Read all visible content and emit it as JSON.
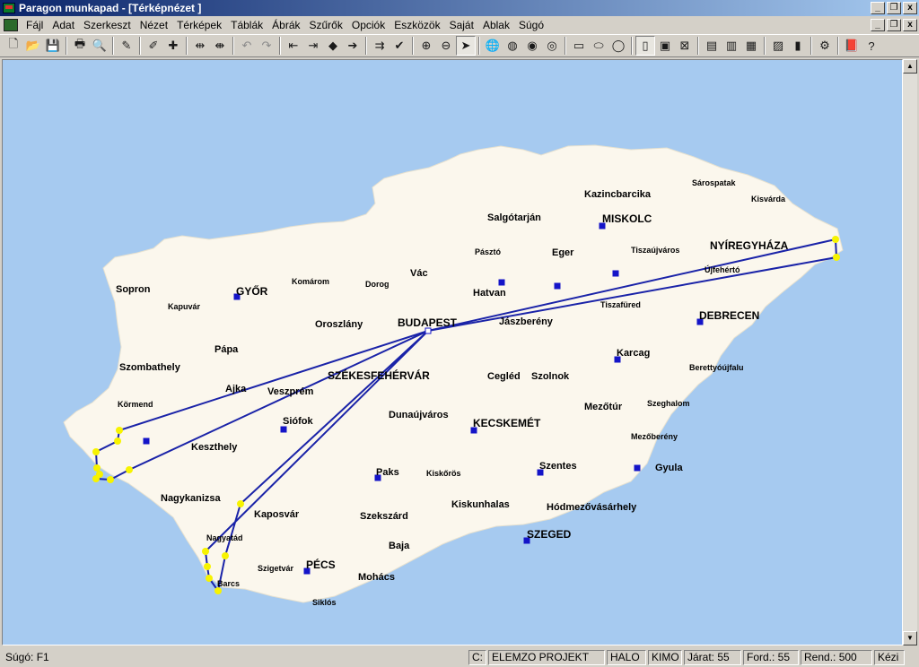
{
  "window": {
    "title": "Paragon munkapad - [Térképnézet ]",
    "min_glyph": "_",
    "max_glyph": "❐",
    "close_glyph": "x"
  },
  "menu": [
    "Fájl",
    "Adat",
    "Szerkeszt",
    "Nézet",
    "Térképek",
    "Táblák",
    "Ábrák",
    "Szűrők",
    "Opciók",
    "Eszközök",
    "Saját",
    "Ablak",
    "Súgó"
  ],
  "toolbar": [
    {
      "name": "new-icon",
      "glyph": "🗋",
      "state": "normal"
    },
    {
      "name": "open-icon",
      "glyph": "📂",
      "state": "normal"
    },
    {
      "name": "save-icon",
      "glyph": "💾",
      "state": "normal"
    },
    {
      "sep": true
    },
    {
      "name": "print-icon",
      "glyph": "🖶",
      "state": "normal"
    },
    {
      "name": "print-preview-icon",
      "glyph": "🔍",
      "state": "normal"
    },
    {
      "sep": true
    },
    {
      "name": "edit-table-icon",
      "glyph": "✎",
      "state": "normal"
    },
    {
      "sep": true
    },
    {
      "name": "edit-route-icon",
      "glyph": "✐",
      "state": "normal"
    },
    {
      "name": "add-stop-icon",
      "glyph": "✚",
      "state": "normal"
    },
    {
      "sep": true
    },
    {
      "name": "join-route-icon",
      "glyph": "⇹",
      "state": "normal"
    },
    {
      "name": "split-route-icon",
      "glyph": "⇼",
      "state": "normal"
    },
    {
      "sep": true
    },
    {
      "name": "undo-icon",
      "glyph": "↶",
      "state": "disabled"
    },
    {
      "name": "redo-icon",
      "glyph": "↷",
      "state": "disabled"
    },
    {
      "sep": true
    },
    {
      "name": "insert-before-icon",
      "glyph": "⇤",
      "state": "normal"
    },
    {
      "name": "insert-after-icon",
      "glyph": "⇥",
      "state": "normal"
    },
    {
      "name": "move-left-icon",
      "glyph": "◆",
      "state": "normal"
    },
    {
      "name": "move-right-icon",
      "glyph": "➔",
      "state": "normal"
    },
    {
      "sep": true
    },
    {
      "name": "route-arrow-icon",
      "glyph": "⇉",
      "state": "normal"
    },
    {
      "name": "check-route-icon",
      "glyph": "✔",
      "state": "normal"
    },
    {
      "sep": true
    },
    {
      "name": "zoom-in-icon",
      "glyph": "⊕",
      "state": "normal"
    },
    {
      "name": "zoom-out-icon",
      "glyph": "⊖",
      "state": "normal"
    },
    {
      "name": "pointer-icon",
      "glyph": "➤",
      "state": "pressed"
    },
    {
      "sep": true
    },
    {
      "name": "globe-icon",
      "glyph": "🌐",
      "state": "normal"
    },
    {
      "name": "globe-zoom-icon",
      "glyph": "◍",
      "state": "normal"
    },
    {
      "name": "globe-layers-icon",
      "glyph": "◉",
      "state": "normal"
    },
    {
      "name": "globe-settings-icon",
      "glyph": "◎",
      "state": "normal"
    },
    {
      "sep": true
    },
    {
      "name": "select-rect-icon",
      "glyph": "▭",
      "state": "normal"
    },
    {
      "name": "select-lasso-icon",
      "glyph": "⬭",
      "state": "normal"
    },
    {
      "name": "select-circle-icon",
      "glyph": "◯",
      "state": "normal"
    },
    {
      "sep": true
    },
    {
      "name": "select-column-icon",
      "glyph": "▯",
      "state": "pressed"
    },
    {
      "name": "select-point-icon",
      "glyph": "▣",
      "state": "normal"
    },
    {
      "name": "clear-selection-icon",
      "glyph": "⊠",
      "state": "normal"
    },
    {
      "sep": true
    },
    {
      "name": "table-view-icon",
      "glyph": "▤",
      "state": "normal"
    },
    {
      "name": "table-edit-icon",
      "glyph": "▥",
      "state": "normal"
    },
    {
      "name": "table-list-icon",
      "glyph": "▦",
      "state": "normal"
    },
    {
      "sep": true
    },
    {
      "name": "gantt-chart-icon",
      "glyph": "▨",
      "state": "normal"
    },
    {
      "name": "bar-chart-icon",
      "glyph": "▮",
      "state": "normal"
    },
    {
      "sep": true
    },
    {
      "name": "settings-icon",
      "glyph": "⚙",
      "state": "normal"
    },
    {
      "sep": true
    },
    {
      "name": "help-book-icon",
      "glyph": "📕",
      "state": "normal"
    },
    {
      "name": "context-help-icon",
      "glyph": "?",
      "state": "normal"
    }
  ],
  "map": {
    "colors": {
      "water": "#a6caf0",
      "land": "#fbf7ed",
      "route": "#1a23a8",
      "stop": "#f7f300",
      "depot": "#1414c8"
    },
    "cities": [
      {
        "text": "Sárospatak",
        "size": "small"
      },
      {
        "text": "Kazincbarcika",
        "size": "normal"
      },
      {
        "text": "Kisvárda",
        "size": "small"
      },
      {
        "text": "Salgótarján",
        "size": "normal"
      },
      {
        "text": "MISKOLC",
        "size": "big"
      },
      {
        "text": "NYÍREGYHÁZA",
        "size": "big"
      },
      {
        "text": "Pásztó",
        "size": "small"
      },
      {
        "text": "Eger",
        "size": "normal"
      },
      {
        "text": "Tiszaújváros",
        "size": "small"
      },
      {
        "text": "Újfehértó",
        "size": "small"
      },
      {
        "text": "Sopron",
        "size": "normal"
      },
      {
        "text": "GYŐR",
        "size": "big"
      },
      {
        "text": "Komárom",
        "size": "small"
      },
      {
        "text": "Dorog",
        "size": "small"
      },
      {
        "text": "Vác",
        "size": "normal"
      },
      {
        "text": "Hatvan",
        "size": "normal"
      },
      {
        "text": "Kapuvár",
        "size": "small"
      },
      {
        "text": "Tiszafüred",
        "size": "small"
      },
      {
        "text": "DEBRECEN",
        "size": "big"
      },
      {
        "text": "Oroszlány",
        "size": "normal"
      },
      {
        "text": "BUDAPEST",
        "size": "big"
      },
      {
        "text": "Jászberény",
        "size": "normal"
      },
      {
        "text": "Pápa",
        "size": "normal"
      },
      {
        "text": "Karcag",
        "size": "normal"
      },
      {
        "text": "Szombathely",
        "size": "normal"
      },
      {
        "text": "SZÉKESFEHÉRVÁR",
        "size": "big"
      },
      {
        "text": "Berettyóújfalu",
        "size": "small"
      },
      {
        "text": "Cegléd",
        "size": "normal"
      },
      {
        "text": "Szolnok",
        "size": "normal"
      },
      {
        "text": "Ajka",
        "size": "normal"
      },
      {
        "text": "Veszprém",
        "size": "normal"
      },
      {
        "text": "Körmend",
        "size": "small"
      },
      {
        "text": "Mezőtúr",
        "size": "normal"
      },
      {
        "text": "Szeghalom",
        "size": "small"
      },
      {
        "text": "Dunaújváros",
        "size": "normal"
      },
      {
        "text": "Siófok",
        "size": "normal"
      },
      {
        "text": "KECSKEMÉT",
        "size": "big"
      },
      {
        "text": "Mezőberény",
        "size": "small"
      },
      {
        "text": "Keszthely",
        "size": "normal"
      },
      {
        "text": "Szentes",
        "size": "normal"
      },
      {
        "text": "Gyula",
        "size": "normal"
      },
      {
        "text": "Paks",
        "size": "normal"
      },
      {
        "text": "Kiskőrös",
        "size": "small"
      },
      {
        "text": "Nagykanizsa",
        "size": "normal"
      },
      {
        "text": "Kiskunhalas",
        "size": "normal"
      },
      {
        "text": "Hódmezővásárhely",
        "size": "normal"
      },
      {
        "text": "Kaposvár",
        "size": "normal"
      },
      {
        "text": "Szekszárd",
        "size": "normal"
      },
      {
        "text": "SZEGED",
        "size": "big"
      },
      {
        "text": "Nagyatád",
        "size": "small"
      },
      {
        "text": "Baja",
        "size": "normal"
      },
      {
        "text": "Szigetvár",
        "size": "small"
      },
      {
        "text": "PÉCS",
        "size": "big"
      },
      {
        "text": "Mohács",
        "size": "normal"
      },
      {
        "text": "Barcs",
        "size": "small"
      },
      {
        "text": "Siklós",
        "size": "small"
      }
    ]
  },
  "statusbar": {
    "help": "Súgó: F1",
    "cells": [
      "C:",
      "ELEMZO PROJEKT",
      "HALO",
      "KIMO",
      "Járat: 55",
      "Ford.: 55",
      "Rend.: 500",
      "Kézi"
    ]
  }
}
